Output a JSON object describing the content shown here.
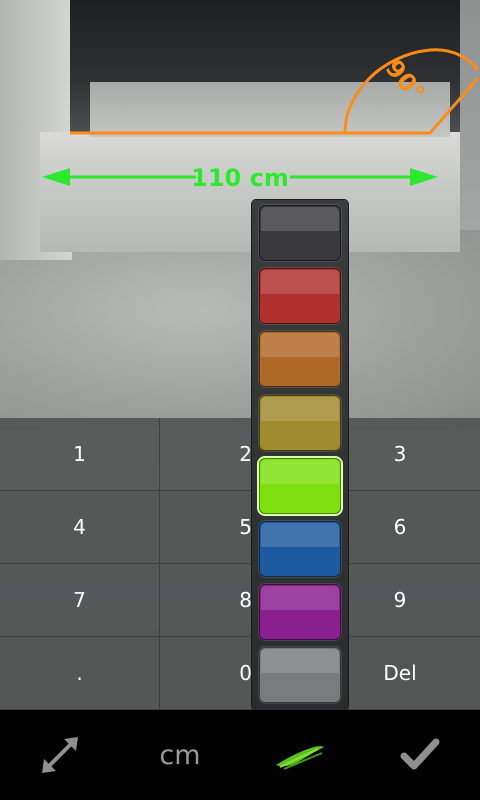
{
  "measurement": {
    "distance_label": "110 cm",
    "angle_label": "90°",
    "line_color": "#2ee82e",
    "angle_color": "#ff8c1a"
  },
  "keypad": {
    "keys": [
      "1",
      "2",
      "3",
      "4",
      "5",
      "6",
      "7",
      "8",
      "9",
      ".",
      "0",
      "Del"
    ]
  },
  "palette": {
    "colors": [
      "#3a3a3c",
      "#b0302e",
      "#b06a28",
      "#a08a2e",
      "#7ee010",
      "#1d5aa0",
      "#8a2090",
      "#7a7b7c"
    ],
    "selected_index": 4
  },
  "toolbar": {
    "measure_icon": "diagonal-arrow-icon",
    "unit_label": "cm",
    "color_icon": "brush-stroke-icon",
    "confirm_icon": "checkmark-icon"
  }
}
